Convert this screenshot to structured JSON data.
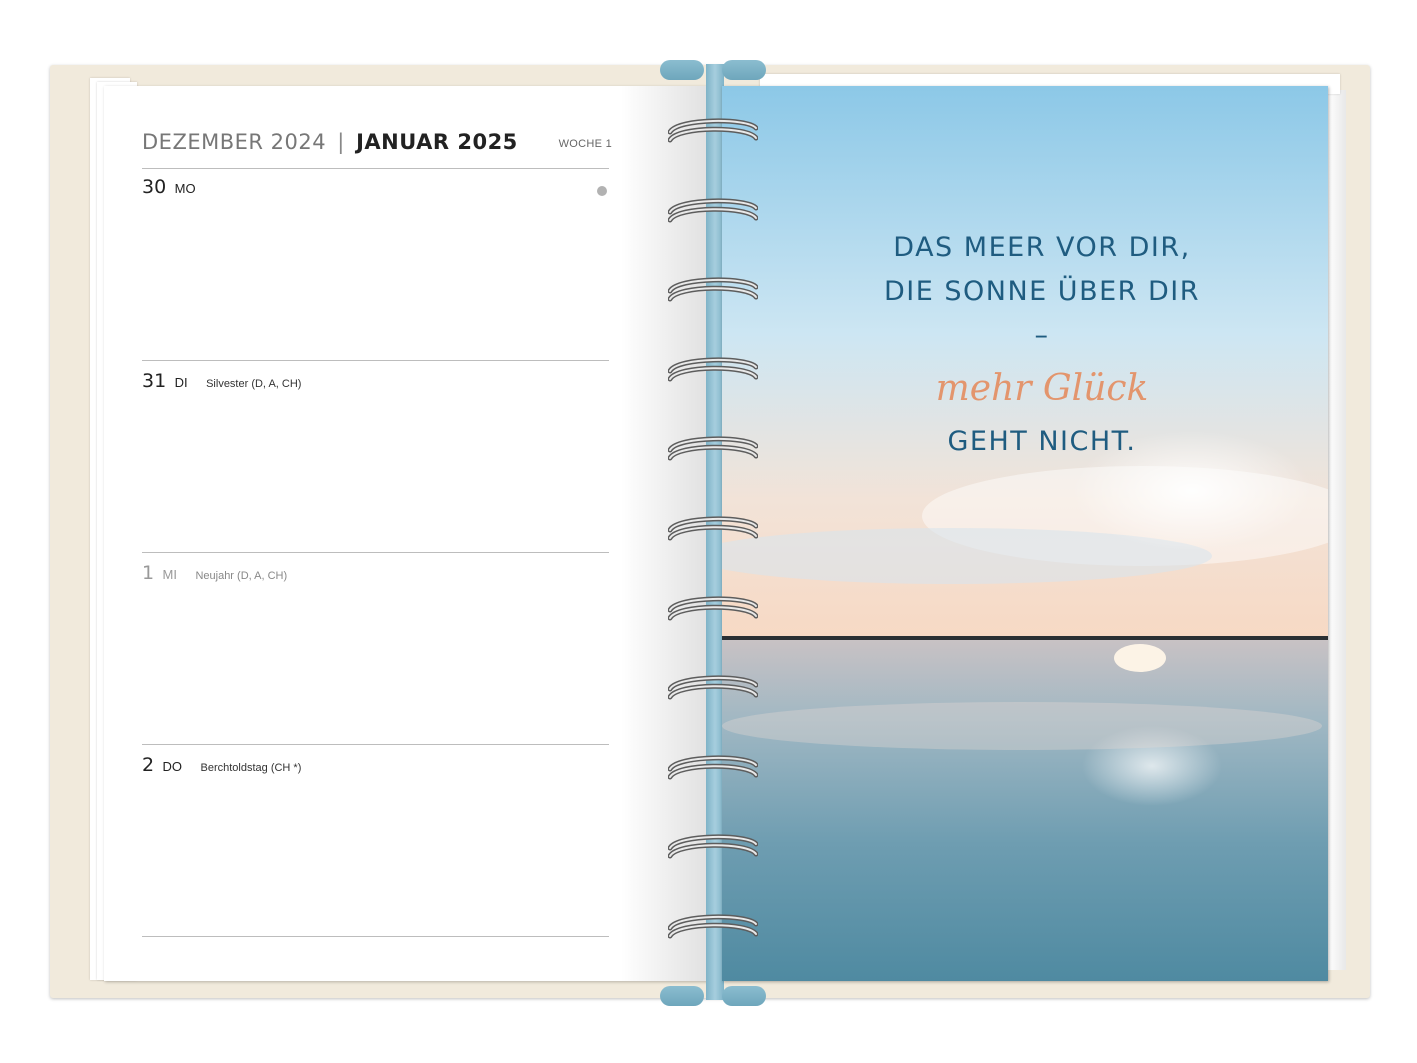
{
  "planner": {
    "header": {
      "month_prev": "DEZEMBER 2024",
      "separator": "|",
      "month_current": "JANUAR 2025",
      "week": "WOCHE 1"
    },
    "days": [
      {
        "number": "30",
        "weekday": "MO",
        "holiday": ""
      },
      {
        "number": "31",
        "weekday": "DI",
        "holiday": "Silvester (D, A, CH)"
      },
      {
        "number": "1",
        "weekday": "MI",
        "holiday": "Neujahr (D, A, CH)"
      },
      {
        "number": "2",
        "weekday": "DO",
        "holiday": "Berchtoldstag (CH *)"
      }
    ]
  },
  "photo_page": {
    "quote_line_1": "DAS MEER VOR DIR,",
    "quote_line_2": "DIE SONNE ÜBER DIR –",
    "quote_script": "mehr Glück",
    "quote_line_3": "GEHT NICHT."
  },
  "colors": {
    "cover": "#f1eadc",
    "spine": "#8bbdd0",
    "quote_text": "#1f5c80",
    "quote_script": "#e3956d"
  }
}
